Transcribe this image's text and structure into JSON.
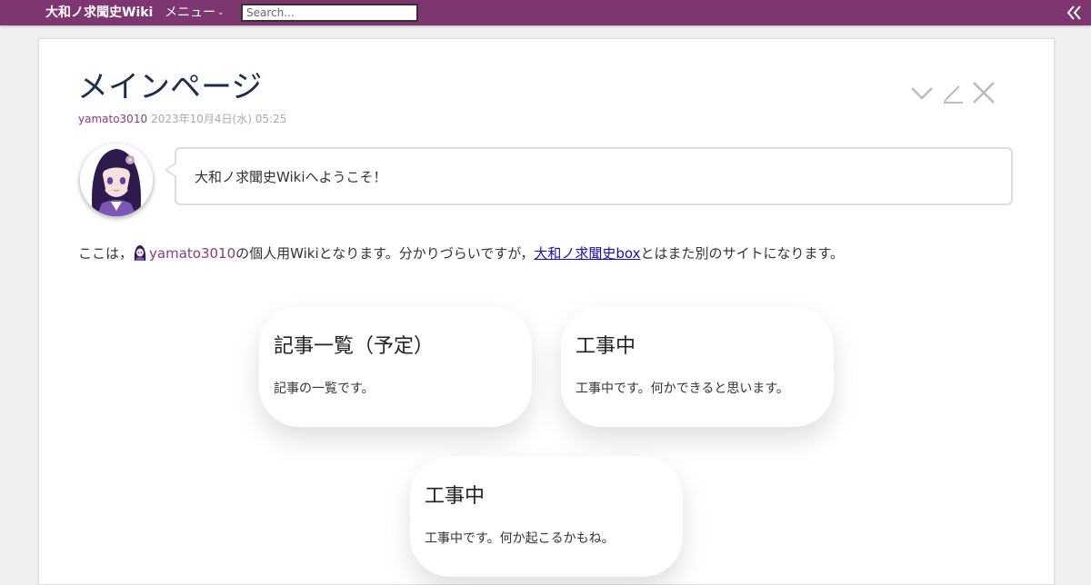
{
  "header": {
    "site_title": "大和ノ求聞史Wiki",
    "menu_label": "メニュー",
    "search_placeholder": "Search..."
  },
  "icons": {
    "menu_caret": "chevron-down-icon",
    "collapse": "double-chevron-left-icon",
    "page_tools": [
      "chevron-down-icon",
      "pencil-icon",
      "close-icon"
    ]
  },
  "page": {
    "title": "メインページ",
    "author": "yamato3010",
    "date": "2023年10月4日(水) 05:25",
    "greeting": "大和ノ求聞史Wikiへようこそ！",
    "intro": {
      "prefix": "ここは，",
      "user": "yamato3010",
      "middle": "の個人用Wikiとなります。分かりづらいですが，",
      "link": "大和ノ求聞史box",
      "suffix": "とはまた別のサイトになります。"
    }
  },
  "tiles": [
    {
      "title": "記事一覧（予定）",
      "desc": "記事の一覧です。"
    },
    {
      "title": "工事中",
      "desc": "工事中です。何かできると思います。"
    },
    {
      "title": "工事中",
      "desc": "工事中です。何か起こるかもね。"
    }
  ],
  "colors": {
    "topbar": "#7e3670",
    "title": "#1a2d4e",
    "author": "#8a3a80",
    "link": "#1a0dab"
  }
}
